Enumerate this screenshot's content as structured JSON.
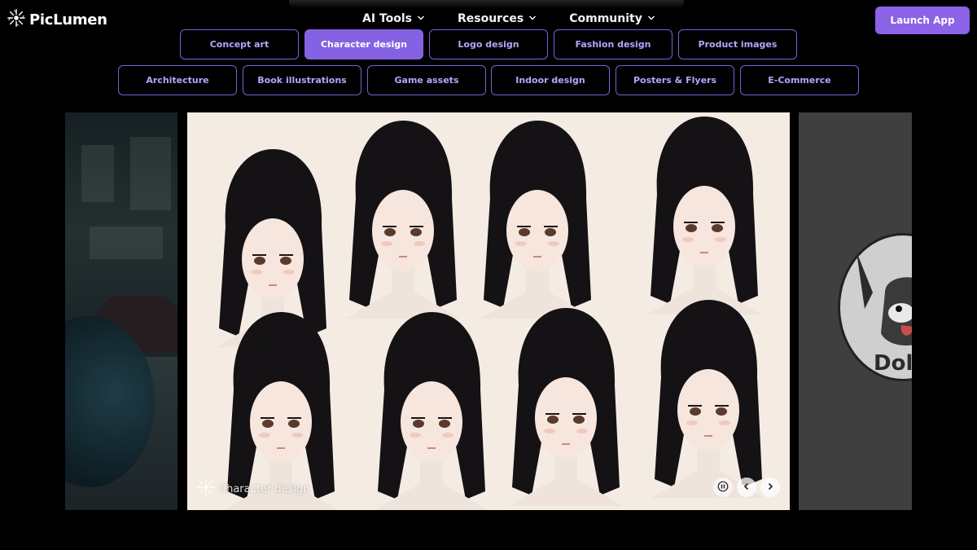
{
  "brand": {
    "name": "PicLumen",
    "icon": "sparkle-logo-icon"
  },
  "nav": {
    "items": [
      {
        "label": "AI Tools",
        "icon": "chevron-down-icon"
      },
      {
        "label": "Resources",
        "icon": "chevron-down-icon"
      },
      {
        "label": "Community",
        "icon": "chevron-down-icon"
      }
    ],
    "launch_label": "Launch App"
  },
  "categories": {
    "row1": [
      {
        "label": "Concept art",
        "active": false
      },
      {
        "label": "Character design",
        "active": true
      },
      {
        "label": "Logo design",
        "active": false
      },
      {
        "label": "Fashion design",
        "active": false
      },
      {
        "label": "Product images",
        "active": false
      }
    ],
    "row2": [
      {
        "label": "Architecture",
        "active": false
      },
      {
        "label": "Book illustrations",
        "active": false
      },
      {
        "label": "Game assets",
        "active": false
      },
      {
        "label": "Indoor design",
        "active": false
      },
      {
        "label": "Posters & Flyers",
        "active": false
      },
      {
        "label": "E-Commerce",
        "active": false
      }
    ]
  },
  "carousel": {
    "caption": "Character design",
    "caption_icon": "sparkle-logo-icon",
    "controls": [
      "pause-icon",
      "chevron-left-icon",
      "chevron-right-icon"
    ],
    "right_slide_text": "Doll"
  },
  "colors": {
    "accent": "#8562e3",
    "pill_border": "#7b5fd8",
    "pill_text": "#b9a3ff",
    "background": "#000000"
  }
}
